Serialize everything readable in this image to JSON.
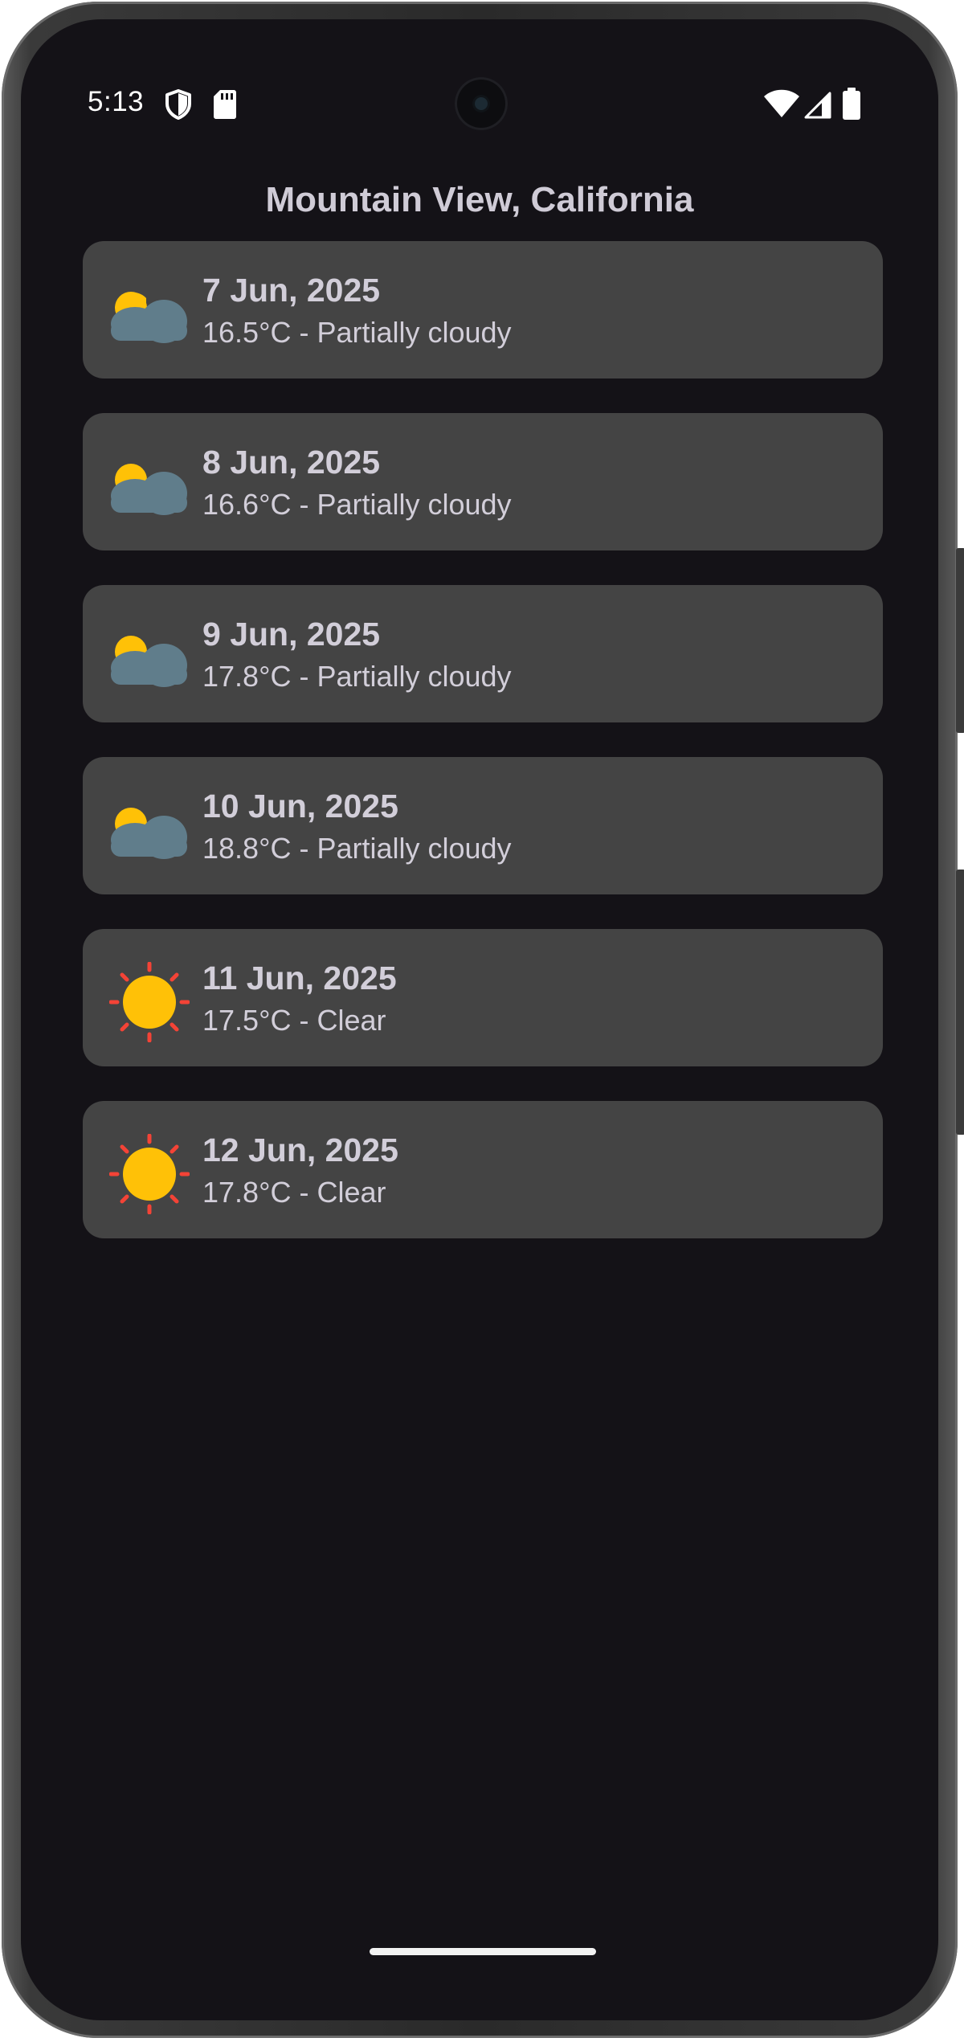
{
  "status_bar": {
    "time": "5:13",
    "left_icons": [
      "shield-icon",
      "sd-card-icon"
    ],
    "right_icons": [
      "wifi-icon",
      "cellular-signal-icon",
      "battery-icon"
    ]
  },
  "header": {
    "title": "Mountain View, California"
  },
  "colors": {
    "screen_background": "#141217",
    "card_background": "#444444",
    "text": "#d2ced9",
    "sun": "#FFC107",
    "sun_rays": "#F44336",
    "cloud": "#607D8B"
  },
  "forecast": [
    {
      "date": "7 Jun, 2025",
      "summary": "16.5°C - Partially cloudy",
      "icon": "partly-cloudy-icon"
    },
    {
      "date": "8 Jun, 2025",
      "summary": "16.6°C - Partially cloudy",
      "icon": "partly-cloudy-icon"
    },
    {
      "date": "9 Jun, 2025",
      "summary": "17.8°C - Partially cloudy",
      "icon": "partly-cloudy-icon"
    },
    {
      "date": "10 Jun, 2025",
      "summary": "18.8°C - Partially cloudy",
      "icon": "partly-cloudy-icon"
    },
    {
      "date": "11 Jun, 2025",
      "summary": "17.5°C - Clear",
      "icon": "sun-icon"
    },
    {
      "date": "12 Jun, 2025",
      "summary": "17.8°C - Clear",
      "icon": "sun-icon"
    }
  ]
}
